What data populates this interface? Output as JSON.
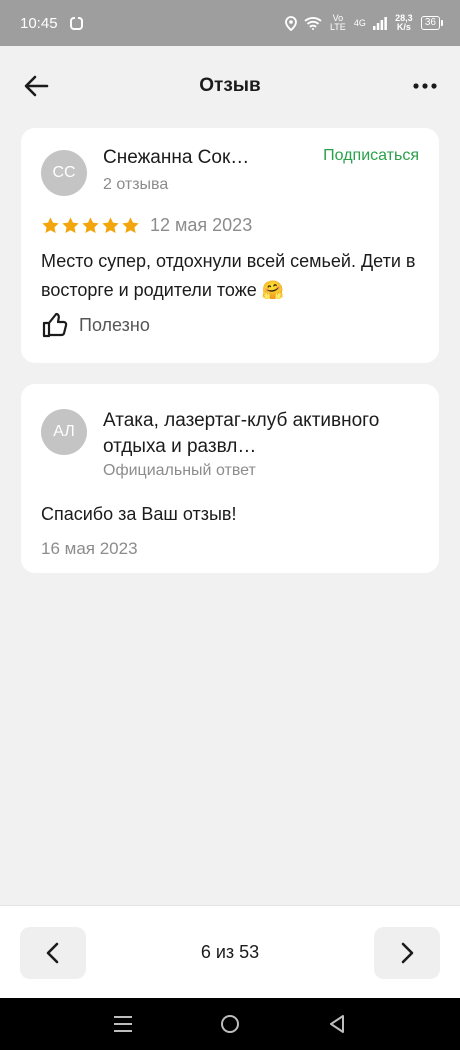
{
  "status_bar": {
    "time": "10:45",
    "network_volte": "Vo LTE",
    "network_4g": "4G",
    "speed": "28,3 K/s",
    "battery": "36"
  },
  "header": {
    "title": "Отзыв",
    "back_icon": "arrow-left-icon",
    "more_icon": "more-horizontal-icon"
  },
  "review": {
    "avatar_initials": "СС",
    "author": "Снежанна Сок…",
    "reviews_count": "2 отзыва",
    "subscribe_label": "Подписаться",
    "rating": 5,
    "rating_max": 5,
    "date": "12 мая 2023",
    "text": "Место супер, отдохнули всей семьей. Дети в восторге и родители тоже 🤗",
    "useful_label": "Полезно"
  },
  "reply": {
    "avatar_initials": "АЛ",
    "author": "Атака, лазертаг-клуб активного отдыха и развл…",
    "subtitle": "Официальный ответ",
    "text": "Спасибо за Ваш отзыв!",
    "date": "16 мая 2023"
  },
  "pager": {
    "text": "6 из 53",
    "prev_icon": "chevron-left-icon",
    "next_icon": "chevron-right-icon"
  },
  "colors": {
    "accent_green": "#2aa14a",
    "star": "#f2a50c",
    "muted": "#8c8c8c",
    "background": "#f1f1f1"
  }
}
